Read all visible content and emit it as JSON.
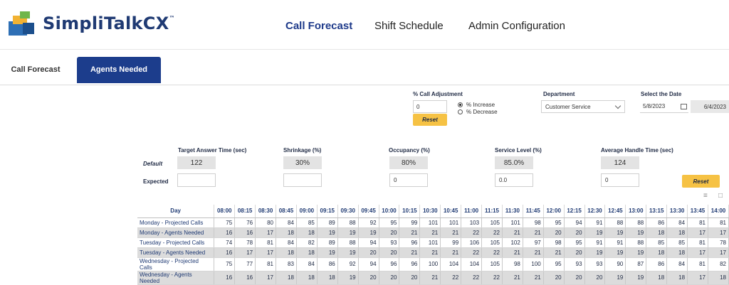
{
  "app": {
    "logo_text": "SimpliTalkCX",
    "logo_tm": "™",
    "nav": [
      "Call Forecast",
      "Shift Schedule",
      "Admin Configuration"
    ],
    "active_nav": "Call Forecast"
  },
  "tabs": {
    "call_forecast": "Call Forecast",
    "agents_needed": "Agents Needed"
  },
  "adjust": {
    "label": "% Call Adjustment",
    "value": "0",
    "reset": "Reset",
    "increase": "% Increase",
    "decrease": "% Decrease",
    "selected": "increase"
  },
  "department": {
    "label": "Department",
    "value": "Customer Service"
  },
  "date": {
    "label": "Select the Date",
    "start": "5/8/2023",
    "end": "6/4/2023"
  },
  "params": {
    "headers": [
      "Target Answer Time (sec)",
      "Shrinkage (%)",
      "Occupancy (%)",
      "Service Level (%)",
      "Average Handle Time (sec)"
    ],
    "default_label": "Default",
    "expected_label": "Expected",
    "defaults": [
      "122",
      "30%",
      "80%",
      "85.0%",
      "124"
    ],
    "expected": [
      "",
      "",
      "0",
      "0.0",
      "0"
    ],
    "reset": "Reset"
  },
  "table": {
    "day_header": "Day",
    "times": [
      "08:00",
      "08:15",
      "08:30",
      "08:45",
      "09:00",
      "09:15",
      "09:30",
      "09:45",
      "10:00",
      "10:15",
      "10:30",
      "10:45",
      "11:00",
      "11:15",
      "11:30",
      "11:45",
      "12:00",
      "12:15",
      "12:30",
      "12:45",
      "13:00",
      "13:15",
      "13:30",
      "13:45",
      "14:00"
    ],
    "rows": [
      {
        "day": "Monday - Projected Calls",
        "kind": "calls",
        "values": [
          "75",
          "76",
          "80",
          "84",
          "85",
          "89",
          "88",
          "92",
          "95",
          "99",
          "101",
          "101",
          "103",
          "105",
          "101",
          "98",
          "95",
          "94",
          "91",
          "88",
          "88",
          "86",
          "84",
          "81",
          "81"
        ]
      },
      {
        "day": "Monday - Agents Needed",
        "kind": "agents",
        "values": [
          "16",
          "16",
          "17",
          "18",
          "18",
          "19",
          "19",
          "19",
          "20",
          "21",
          "21",
          "21",
          "22",
          "22",
          "21",
          "21",
          "20",
          "20",
          "19",
          "19",
          "19",
          "18",
          "18",
          "17",
          "17"
        ]
      },
      {
        "day": "Tuesday - Projected Calls",
        "kind": "calls",
        "values": [
          "74",
          "78",
          "81",
          "84",
          "82",
          "89",
          "88",
          "94",
          "93",
          "96",
          "101",
          "99",
          "106",
          "105",
          "102",
          "97",
          "98",
          "95",
          "91",
          "91",
          "88",
          "85",
          "85",
          "81",
          "78"
        ]
      },
      {
        "day": "Tuesday - Agents Needed",
        "kind": "agents",
        "values": [
          "16",
          "17",
          "17",
          "18",
          "18",
          "19",
          "19",
          "20",
          "20",
          "21",
          "21",
          "21",
          "22",
          "22",
          "21",
          "21",
          "21",
          "20",
          "19",
          "19",
          "19",
          "18",
          "18",
          "17",
          "17"
        ]
      },
      {
        "day": "Wednesday - Projected Calls",
        "kind": "calls",
        "values": [
          "75",
          "77",
          "81",
          "83",
          "84",
          "86",
          "92",
          "94",
          "96",
          "96",
          "100",
          "104",
          "104",
          "105",
          "98",
          "100",
          "95",
          "93",
          "93",
          "90",
          "87",
          "86",
          "84",
          "81",
          "82"
        ]
      },
      {
        "day": "Wednesday - Agents Needed",
        "kind": "agents",
        "values": [
          "16",
          "16",
          "17",
          "18",
          "18",
          "18",
          "19",
          "20",
          "20",
          "20",
          "21",
          "22",
          "22",
          "22",
          "21",
          "21",
          "20",
          "20",
          "20",
          "19",
          "19",
          "18",
          "18",
          "17",
          "18"
        ]
      }
    ]
  }
}
